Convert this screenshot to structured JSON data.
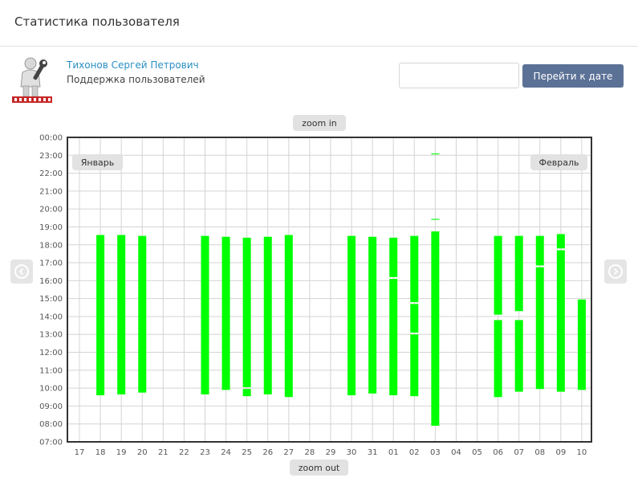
{
  "page": {
    "title": "Статистика пользователя"
  },
  "user": {
    "name": "Тихонов Сергей Петрович",
    "role": "Поддержка пользователей",
    "avatar_icon": "support-wrench-man-icon"
  },
  "date_search": {
    "value": "",
    "placeholder": "",
    "button_label": "Перейти к дате"
  },
  "controls": {
    "zoom_in_label": "zoom in",
    "zoom_out_label": "zoom out",
    "prev_icon": "chevron-left-circle-icon",
    "next_icon": "chevron-right-circle-icon"
  },
  "months": {
    "left": "Январь",
    "right": "Февраль"
  },
  "colors": {
    "bar": "#00ff00",
    "frame": "#333333",
    "grid": "#d4d4d4",
    "button": "#5b7196",
    "link": "#2a8fc4"
  },
  "chart_data": {
    "type": "bar",
    "orientation": "vertical-range",
    "y_axis": {
      "min_hour": 7,
      "max_hour": 24,
      "tick_labels": [
        "00:00",
        "23:00",
        "22:00",
        "21:00",
        "20:00",
        "19:00",
        "18:00",
        "17:00",
        "16:00",
        "15:00",
        "14:00",
        "13:00",
        "12:00",
        "11:00",
        "10:00",
        "09:00",
        "08:00",
        "07:00"
      ]
    },
    "grid": true,
    "categories": [
      "17",
      "18",
      "19",
      "20",
      "21",
      "22",
      "23",
      "24",
      "25",
      "26",
      "27",
      "28",
      "29",
      "30",
      "31",
      "01",
      "02",
      "03",
      "04",
      "05",
      "06",
      "07",
      "08",
      "09",
      "10"
    ],
    "days": [
      {
        "label": "17",
        "segments": []
      },
      {
        "label": "18",
        "segments": [
          [
            9.6,
            18.55
          ]
        ]
      },
      {
        "label": "19",
        "segments": [
          [
            9.65,
            18.55
          ]
        ]
      },
      {
        "label": "20",
        "segments": [
          [
            9.75,
            18.5
          ]
        ]
      },
      {
        "label": "21",
        "segments": []
      },
      {
        "label": "22",
        "segments": []
      },
      {
        "label": "23",
        "segments": [
          [
            9.65,
            18.5
          ]
        ]
      },
      {
        "label": "24",
        "segments": [
          [
            9.9,
            18.45
          ]
        ]
      },
      {
        "label": "25",
        "segments": [
          [
            9.55,
            9.95
          ],
          [
            10.05,
            18.4
          ]
        ]
      },
      {
        "label": "26",
        "segments": [
          [
            9.65,
            18.45
          ]
        ]
      },
      {
        "label": "27",
        "segments": [
          [
            9.5,
            18.55
          ]
        ]
      },
      {
        "label": "28",
        "segments": []
      },
      {
        "label": "29",
        "segments": []
      },
      {
        "label": "30",
        "segments": [
          [
            9.6,
            18.5
          ]
        ]
      },
      {
        "label": "31",
        "segments": [
          [
            9.7,
            18.45
          ]
        ]
      },
      {
        "label": "01",
        "segments": [
          [
            9.6,
            16.1
          ],
          [
            16.2,
            18.4
          ]
        ]
      },
      {
        "label": "02",
        "segments": [
          [
            9.55,
            13.0
          ],
          [
            13.1,
            14.7
          ],
          [
            14.8,
            18.5
          ]
        ]
      },
      {
        "label": "03",
        "segments": [
          [
            7.9,
            18.75
          ],
          [
            19.4,
            19.45
          ],
          [
            23.05,
            23.1
          ]
        ]
      },
      {
        "label": "04",
        "segments": []
      },
      {
        "label": "05",
        "segments": []
      },
      {
        "label": "06",
        "segments": [
          [
            9.5,
            13.8
          ],
          [
            14.1,
            18.5
          ]
        ]
      },
      {
        "label": "07",
        "segments": [
          [
            9.8,
            13.8
          ],
          [
            14.3,
            18.5
          ]
        ]
      },
      {
        "label": "08",
        "segments": [
          [
            9.95,
            16.75
          ],
          [
            16.85,
            18.5
          ]
        ]
      },
      {
        "label": "09",
        "segments": [
          [
            9.8,
            17.7
          ],
          [
            17.8,
            18.6
          ]
        ]
      },
      {
        "label": "10",
        "segments": [
          [
            9.9,
            14.95
          ]
        ]
      }
    ]
  }
}
